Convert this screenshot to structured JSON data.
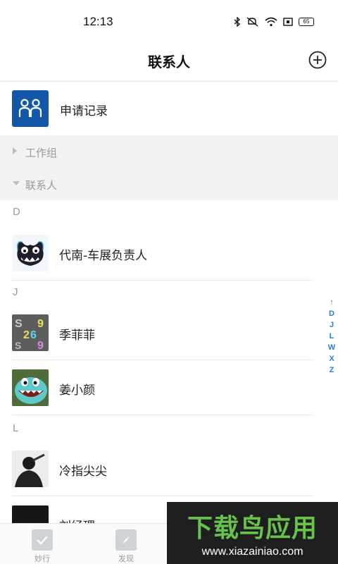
{
  "status_bar": {
    "time": "12:13",
    "battery": "65"
  },
  "nav": {
    "title": "联系人"
  },
  "apply_record": {
    "label": "申请记录"
  },
  "groups": [
    {
      "label": "工作组",
      "expanded": false
    },
    {
      "label": "联系人",
      "expanded": true
    }
  ],
  "sections": [
    {
      "letter": "D",
      "contacts": [
        {
          "name": "代南-车展负责人"
        }
      ]
    },
    {
      "letter": "J",
      "contacts": [
        {
          "name": "季菲菲"
        },
        {
          "name": "姜小颜"
        }
      ]
    },
    {
      "letter": "L",
      "contacts": [
        {
          "name": "冷指尖尖"
        },
        {
          "name": "刘经理"
        }
      ]
    }
  ],
  "index_bar": {
    "arrow": "↑",
    "letters": [
      "D",
      "J",
      "L",
      "W",
      "X",
      "Z"
    ]
  },
  "tab_bar": {
    "tabs": [
      {
        "label": "妙行",
        "icon": "check-icon"
      },
      {
        "label": "发现",
        "icon": "compass-icon"
      }
    ]
  },
  "watermark": {
    "title": "下载鸟应用",
    "url": "www.xiazainiao.com"
  },
  "colors": {
    "accent": "#2b7fd6",
    "apply_icon_bg": "#1257a8",
    "group_bg": "#f3f3f3",
    "watermark_green": "#67c24c"
  }
}
